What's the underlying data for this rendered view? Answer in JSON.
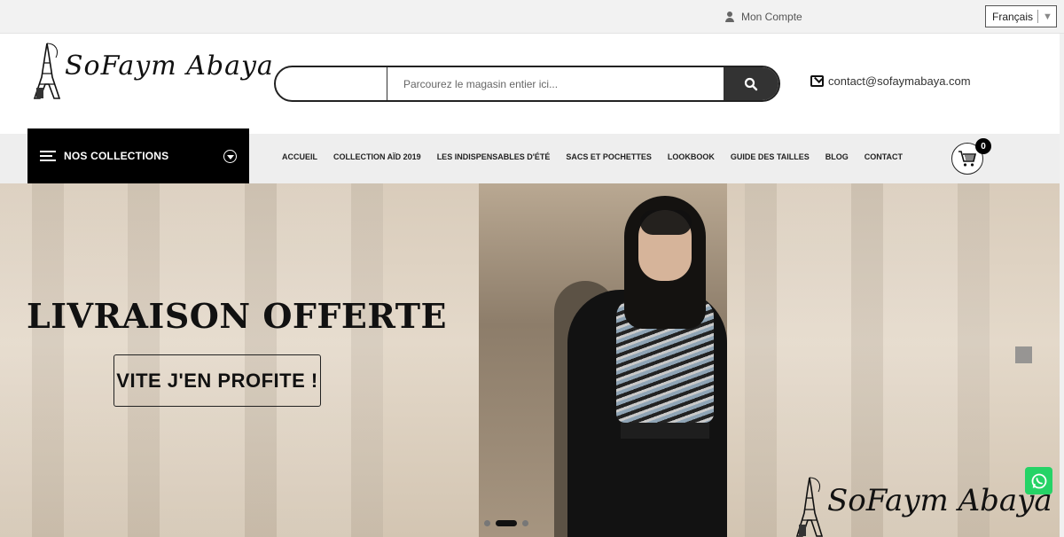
{
  "topbar": {
    "account_label": "Mon Compte",
    "language": "Français"
  },
  "header": {
    "logo_text": "SoFaym Abaya",
    "search_placeholder": "Parcourez le magasin entier ici...",
    "contact_email": "contact@sofaymabaya.com"
  },
  "nav": {
    "collections_label": "NOS COLLECTIONS",
    "items": [
      {
        "label": "ACCUEIL"
      },
      {
        "label": "COLLECTION AÏD 2019"
      },
      {
        "label": "LES INDISPENSABLES D'ÉTÉ"
      },
      {
        "label": "SACS ET POCHETTES"
      },
      {
        "label": "LOOKBOOK"
      },
      {
        "label": "GUIDE DES TAILLES"
      },
      {
        "label": "BLOG"
      },
      {
        "label": "CONTACT"
      }
    ],
    "cart_count": "0"
  },
  "hero": {
    "headline": "LIVRAISON OFFERTE",
    "cta_label": "VITE J'EN PROFITE !",
    "watermark_text": "SoFaym Abaya",
    "slides": 3,
    "active_slide": 2
  },
  "colors": {
    "primary": "#000000",
    "search_button": "#333333",
    "whatsapp": "#25d366"
  },
  "icons": [
    "user-icon",
    "search-icon",
    "mail-icon",
    "menu-icon",
    "chevron-down-icon",
    "cart-icon",
    "whatsapp-icon",
    "eiffel-tower-logo"
  ]
}
